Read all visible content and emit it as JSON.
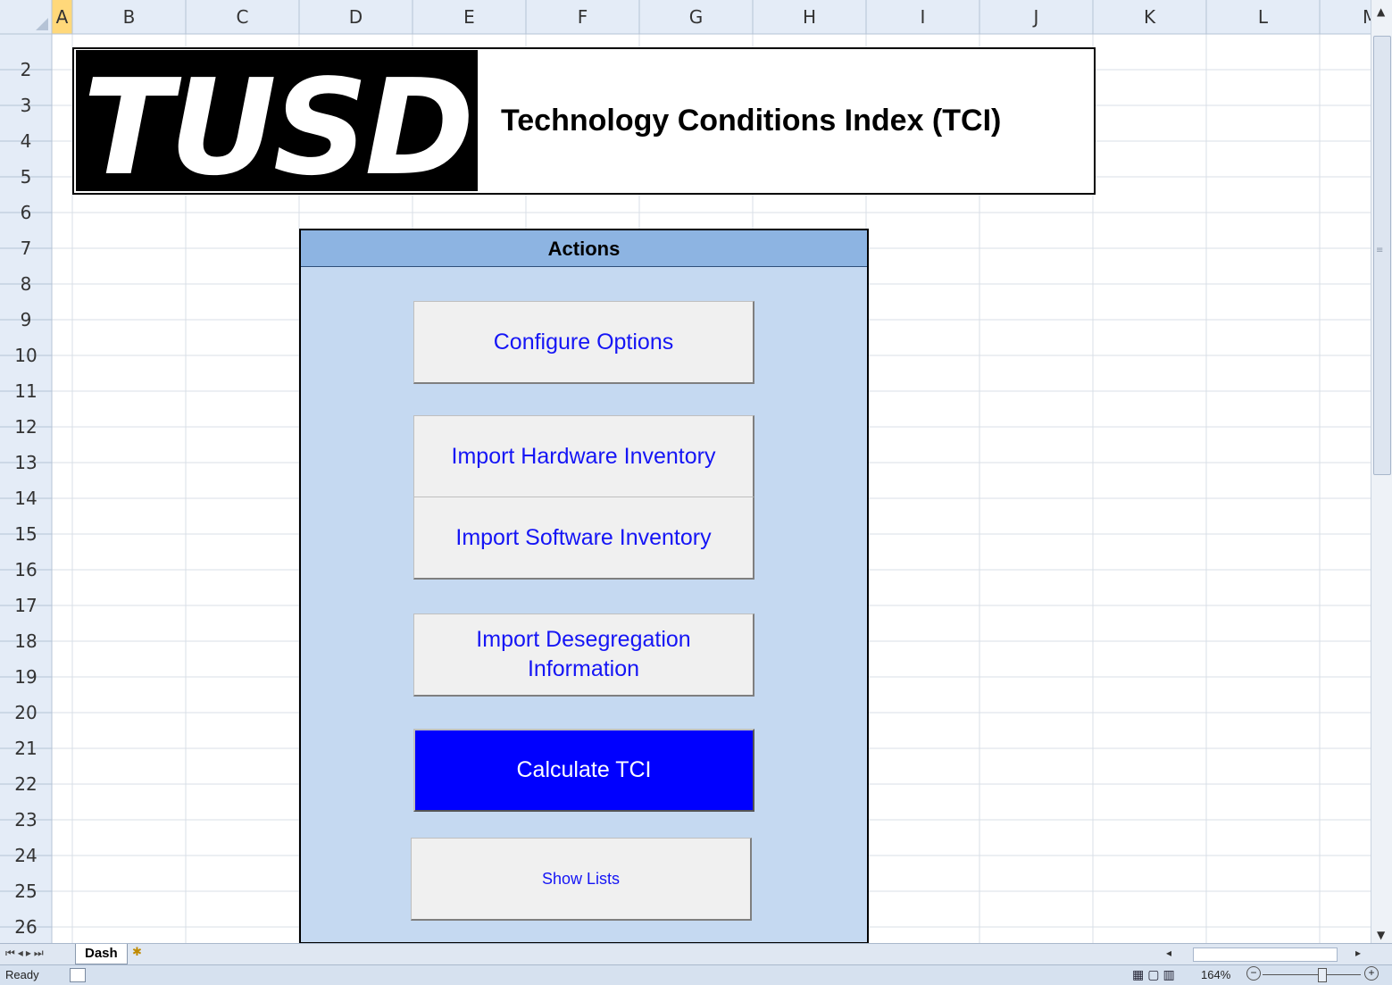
{
  "spreadsheet": {
    "columns": [
      "A",
      "B",
      "C",
      "D",
      "E",
      "F",
      "G",
      "H",
      "I",
      "J",
      "K",
      "L",
      "M"
    ],
    "rows": [
      "2",
      "3",
      "4",
      "5",
      "6",
      "7",
      "8",
      "9",
      "10",
      "11",
      "12",
      "13",
      "14",
      "15",
      "16",
      "17",
      "18",
      "19",
      "20",
      "21",
      "22",
      "23",
      "24",
      "25",
      "26"
    ],
    "selected_column": "A"
  },
  "banner": {
    "logo_text": "TUSD",
    "title": "Technology Conditions Index (TCI)"
  },
  "actions": {
    "header": "Actions",
    "buttons": {
      "configure": "Configure Options",
      "import_hardware": "Import Hardware Inventory",
      "import_software": "Import Software Inventory",
      "import_desegregation_line1": "Import Desegregation",
      "import_desegregation_line2": "Information",
      "calculate": "Calculate TCI",
      "show_lists": "Show Lists"
    }
  },
  "tabs": {
    "sheet_name": "Dash"
  },
  "status": {
    "text": "Ready",
    "zoom": "164%"
  },
  "colors": {
    "actions_bg": "#c5d9f1",
    "actions_header": "#8db4e2",
    "button_text": "#1515f5",
    "primary_button": "#0000ff"
  }
}
